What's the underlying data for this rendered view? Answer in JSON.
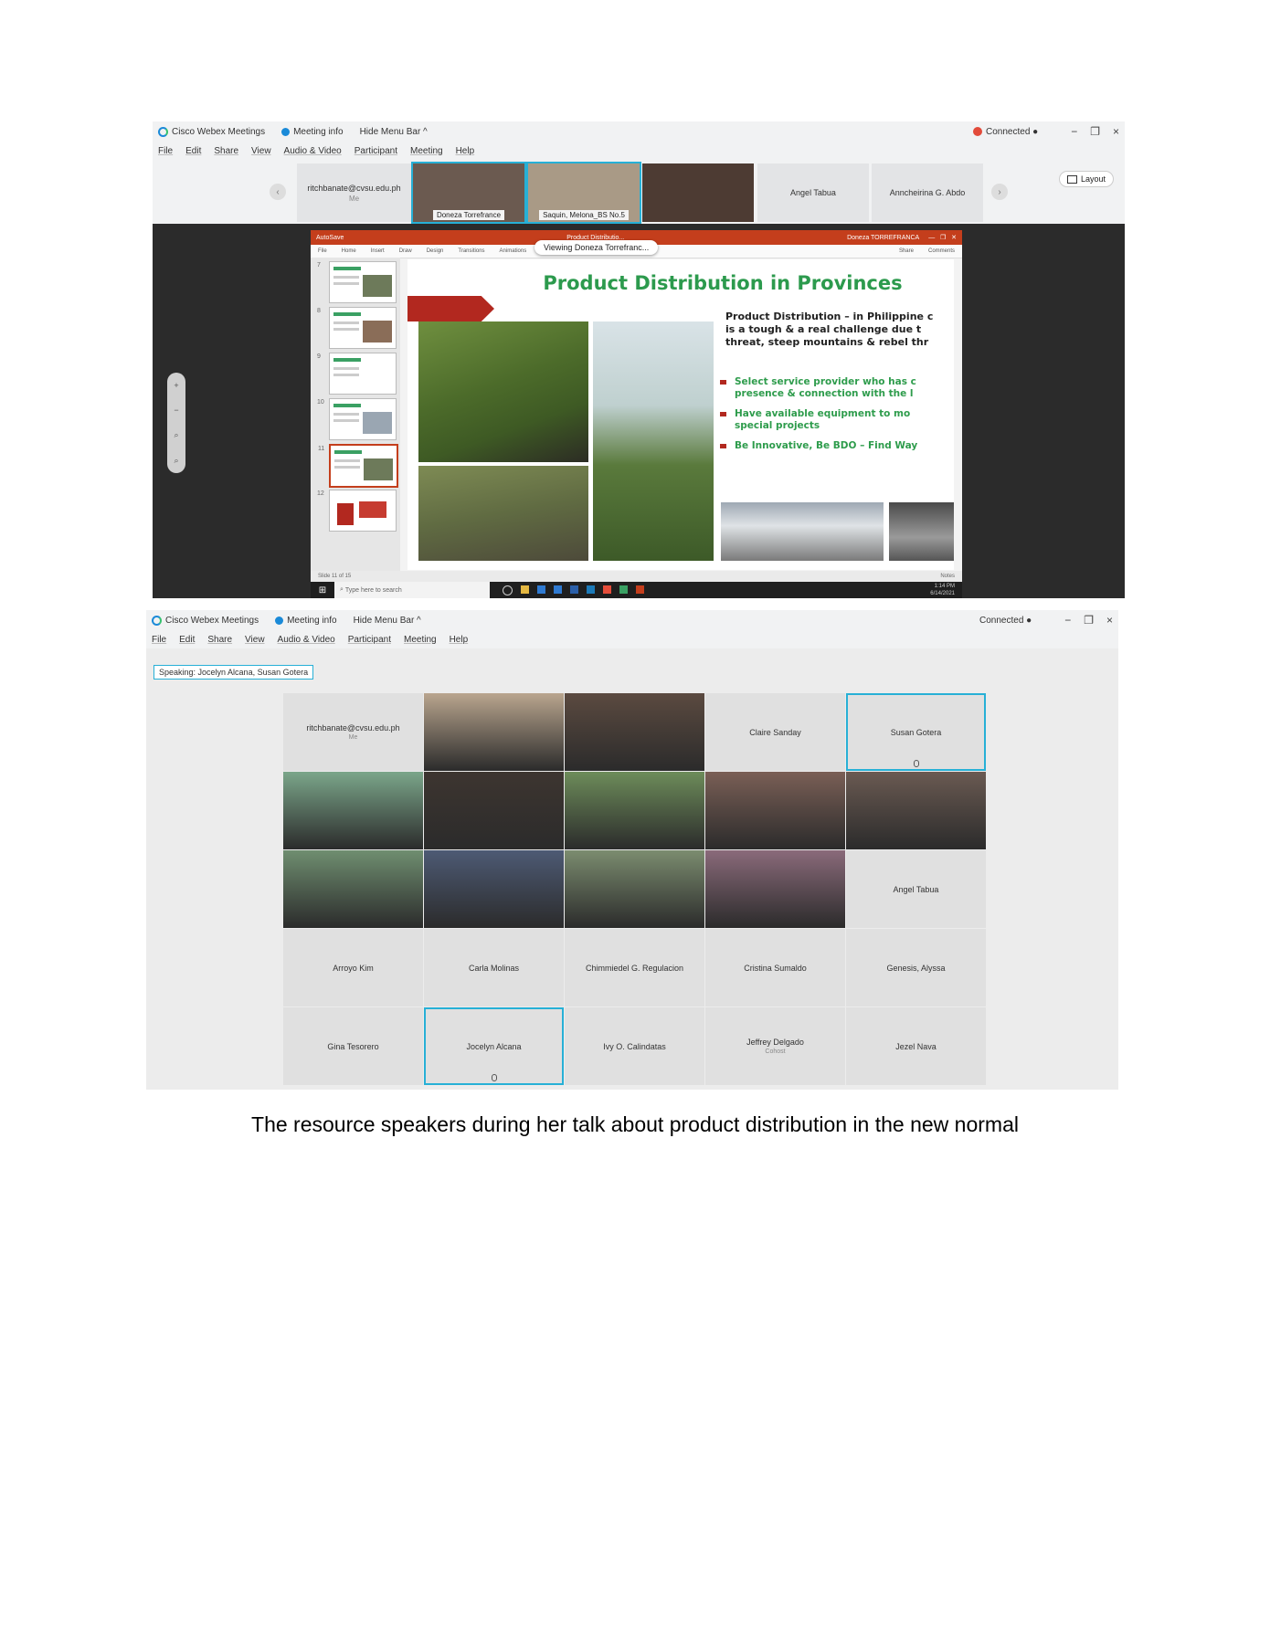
{
  "screenshot1": {
    "titlebar": {
      "app_name": "Cisco Webex Meetings",
      "meeting_info": "Meeting info",
      "hide_menu_bar": "Hide Menu Bar ^",
      "status": "Connected ●",
      "window_controls": [
        "−",
        "❐",
        "×"
      ]
    },
    "menu": [
      "File",
      "Edit",
      "Share",
      "View",
      "Audio & Video",
      "Participant",
      "Meeting",
      "Help"
    ],
    "strip": [
      {
        "name": "ritchbanate@cvsu.edu.ph",
        "sub": "Me",
        "video": false
      },
      {
        "name": "Doneza Torrefrance",
        "video": true
      },
      {
        "name": "Saquin, Melona_BS No.5",
        "video": true
      },
      {
        "name": "",
        "video": true
      },
      {
        "name": "Angel Tabua",
        "video": false
      },
      {
        "name": "Anncheirina G. Abdo",
        "video": false
      }
    ],
    "layout_label": "Layout",
    "viewing": "Viewing Doneza Torrefranc...",
    "zoom_controls": [
      "+",
      "−",
      "⌕",
      "⌕"
    ],
    "ppt": {
      "title_items": [
        "AutoSave",
        "Product Distributio...",
        "Doneza TORREFRANCA"
      ],
      "ribbon": [
        "File",
        "Home",
        "Insert",
        "Draw",
        "Design",
        "Transitions",
        "Animations",
        "Share",
        "Comments"
      ],
      "thumbnails": [
        "7",
        "8",
        "9",
        "10",
        "11",
        "12"
      ],
      "selected_thumbnail": "11",
      "slide": {
        "title": "Product Distribution in Provinces",
        "body": [
          "Product Distribution – in Philippine c",
          "is a tough & a real challenge due t",
          "threat,  steep mountains & rebel thr"
        ],
        "bullets": [
          "Select service provider who has c",
          "presence & connection with the l",
          "Have available equipment to mo",
          "special projects",
          "Be Innovative, Be BDO – Find Way"
        ]
      },
      "status_left": "Slide 11 of 15",
      "status_right": "Notes"
    },
    "taskbar": {
      "search": "Type here to search",
      "clock_time": "1:14 PM",
      "clock_date": "6/14/2021"
    }
  },
  "screenshot2": {
    "titlebar": {
      "app_name": "Cisco Webex Meetings",
      "meeting_info": "Meeting info",
      "hide_menu_bar": "Hide Menu Bar ^",
      "status": "Connected ●",
      "window_controls": [
        "−",
        "❐",
        "×"
      ]
    },
    "menu": [
      "File",
      "Edit",
      "Share",
      "View",
      "Audio & Video",
      "Participant",
      "Meeting",
      "Help"
    ],
    "speaking": "Speaking: Jocelyn Alcana, Susan Gotera",
    "grid": [
      {
        "name": "ritchbanate@cvsu.edu.ph",
        "sub": "Me",
        "video": false
      },
      {
        "name": "",
        "video": true,
        "tone": "#b9a58e"
      },
      {
        "name": "",
        "video": true,
        "tone": "#5b4a40"
      },
      {
        "name": "Claire Sanday",
        "video": false
      },
      {
        "name": "Susan Gotera",
        "video": false,
        "active": true
      },
      {
        "name": "",
        "video": true,
        "tone": "#7ba68a"
      },
      {
        "name": "",
        "video": true,
        "tone": "#3d3530"
      },
      {
        "name": "",
        "video": true,
        "tone": "#6d8c5a"
      },
      {
        "name": "",
        "video": true,
        "tone": "#7a5f56"
      },
      {
        "name": "",
        "video": true,
        "tone": "#6a5a52"
      },
      {
        "name": "",
        "video": true,
        "tone": "#6f8e70"
      },
      {
        "name": "",
        "video": true,
        "tone": "#4d5a74"
      },
      {
        "name": "",
        "video": true,
        "tone": "#7b8c6f"
      },
      {
        "name": "",
        "video": true,
        "tone": "#8a6a7a"
      },
      {
        "name": "Angel Tabua",
        "video": false
      },
      {
        "name": "Arroyo Kim",
        "video": false
      },
      {
        "name": "Carla Molinas",
        "video": false
      },
      {
        "name": "Chimmiedel G. Regulacion",
        "video": false
      },
      {
        "name": "Cristina Sumaldo",
        "video": false
      },
      {
        "name": "Genesis, Alyssa",
        "video": false
      },
      {
        "name": "Gina Tesorero",
        "video": false
      },
      {
        "name": "Jocelyn Alcana",
        "video": false,
        "active": true
      },
      {
        "name": "Ivy O. Calindatas",
        "video": false
      },
      {
        "name": "Jeffrey Delgado",
        "sub": "Cohost",
        "video": false
      },
      {
        "name": "Jezel Nava",
        "video": false
      }
    ]
  },
  "caption": "The resource speakers during her talk about product distribution in the new normal",
  "colors": {
    "accent": "#27b0d6",
    "slide_green": "#2c9a4d",
    "slide_red": "#b2281f",
    "ppt_bar": "#c43e1c"
  }
}
